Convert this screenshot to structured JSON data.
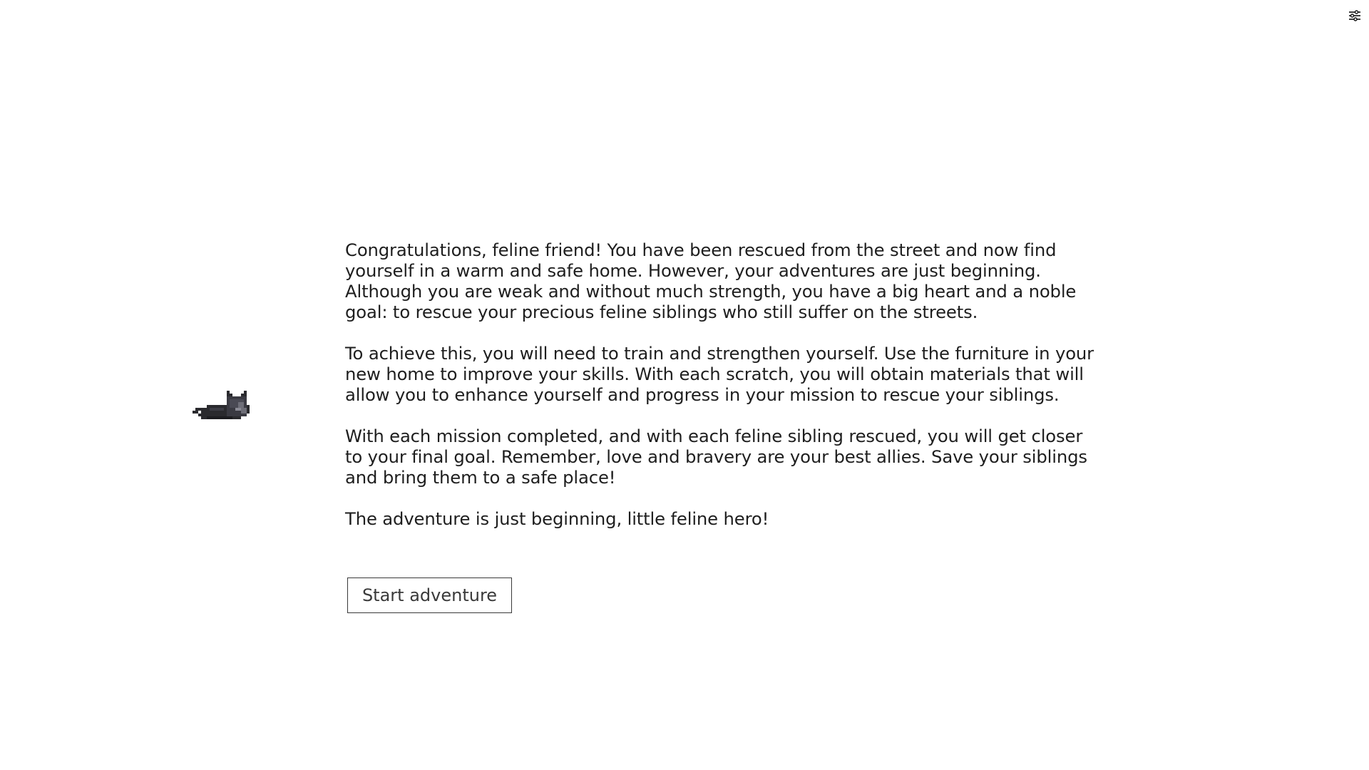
{
  "header": {
    "settings_icon": "sliders-icon"
  },
  "intro": {
    "sprite": "sleeping-cat-icon",
    "paragraphs": [
      "Congratulations, feline friend! You have been rescued from the street and now find yourself in a warm and safe home. However, your adventures are just beginning. Although you are weak and without much strength, you have a big heart and a noble goal: to rescue your precious feline siblings who still suffer on the streets.",
      "To achieve this, you will need to train and strengthen yourself. Use the furniture in your new home to improve your skills. With each scratch, you will obtain materials that will allow you to enhance yourself and progress in your mission to rescue your siblings.",
      "With each mission completed, and with each feline sibling rescued, you will get closer to your final goal. Remember, love and bravery are your best allies. Save your siblings and bring them to a safe place!",
      "The adventure is just beginning, little feline hero!"
    ],
    "start_button_label": "Start adventure"
  },
  "colors": {
    "background": "#ffffff",
    "text": "#1e1e1e",
    "button_border": "#3a3a3a",
    "cat_body": "#2a2a2e",
    "cat_highlight": "#6e6e78"
  }
}
